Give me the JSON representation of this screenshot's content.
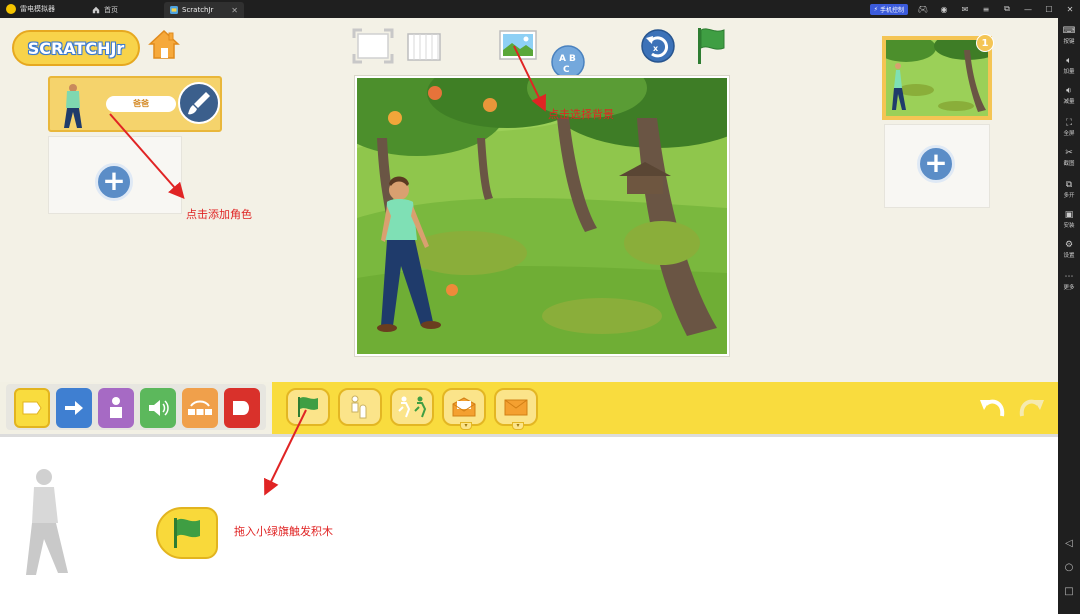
{
  "titlebar": {
    "app_name": "雷电模拟器",
    "tabs": [
      {
        "label": "首页",
        "icon": "home-icon"
      },
      {
        "label": "ScratchJr",
        "icon": "scratchjr-icon"
      }
    ],
    "phone_control": "手机控制"
  },
  "sidebar": {
    "items": [
      {
        "label": "按键",
        "icon": "keyboard-icon"
      },
      {
        "label": "加量",
        "icon": "volume-up-icon"
      },
      {
        "label": "减量",
        "icon": "volume-down-icon"
      },
      {
        "label": "全屏",
        "icon": "fullscreen-icon"
      },
      {
        "label": "截图",
        "icon": "scissors-icon"
      },
      {
        "label": "多开",
        "icon": "multi-instance-icon"
      },
      {
        "label": "安装",
        "icon": "apk-install-icon"
      },
      {
        "label": "设置",
        "icon": "gear-icon"
      },
      {
        "label": "更多",
        "icon": "more-icon"
      }
    ]
  },
  "app": {
    "logo_text": "SCRATCHJr",
    "sprite": {
      "name": "爸爸"
    },
    "pages": {
      "count": "1"
    }
  },
  "annotations": {
    "add_character": "点击添加角色",
    "choose_background": "点击选择背景",
    "drag_flag_block": "拖入小绿旗触发积木"
  },
  "colors": {
    "trigger_yellow": "#f9dc3e",
    "motion_blue": "#3f7fd1",
    "looks_purple": "#a66ac4",
    "sound_green": "#5cb85c",
    "control_orange": "#f0a04b",
    "end_red": "#d9312b",
    "annotation_red": "#e02424"
  }
}
